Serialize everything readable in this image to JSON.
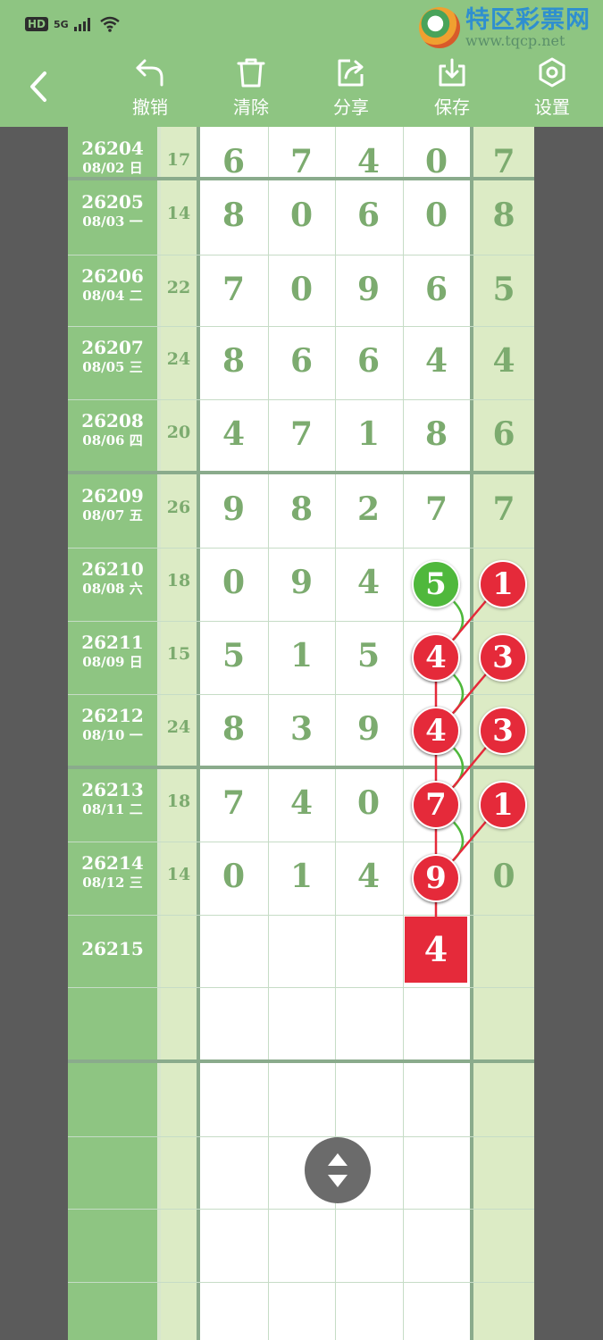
{
  "status_bar": {
    "hd": "HD",
    "network": "5G",
    "watermark_title": "特区彩票网",
    "watermark_url": "www.tqcp.net"
  },
  "toolbar": {
    "buttons": [
      {
        "label": "撤销",
        "icon": "undo-icon"
      },
      {
        "label": "清除",
        "icon": "trash-icon"
      },
      {
        "label": "分享",
        "icon": "share-icon"
      },
      {
        "label": "保存",
        "icon": "download-icon"
      },
      {
        "label": "设置",
        "icon": "settings-icon"
      }
    ]
  },
  "rows": [
    {
      "issue": "26204",
      "date": "08/02 日",
      "sum": "17",
      "digits": [
        "6",
        "7",
        "4",
        "0"
      ],
      "last": "7"
    },
    {
      "issue": "26205",
      "date": "08/03 一",
      "sum": "14",
      "digits": [
        "8",
        "0",
        "6",
        "0"
      ],
      "last": "8"
    },
    {
      "issue": "26206",
      "date": "08/04 二",
      "sum": "22",
      "digits": [
        "7",
        "0",
        "9",
        "6"
      ],
      "last": "5"
    },
    {
      "issue": "26207",
      "date": "08/05 三",
      "sum": "24",
      "digits": [
        "8",
        "6",
        "6",
        "4"
      ],
      "last": "4"
    },
    {
      "issue": "26208",
      "date": "08/06 四",
      "sum": "20",
      "digits": [
        "4",
        "7",
        "1",
        "8"
      ],
      "last": "6"
    },
    {
      "issue": "26209",
      "date": "08/07 五",
      "sum": "26",
      "digits": [
        "9",
        "8",
        "2",
        "7"
      ],
      "last": "7"
    },
    {
      "issue": "26210",
      "date": "08/08 六",
      "sum": "18",
      "digits": [
        "0",
        "9",
        "4",
        "5"
      ],
      "last": "1"
    },
    {
      "issue": "26211",
      "date": "08/09 日",
      "sum": "15",
      "digits": [
        "5",
        "1",
        "5",
        "4"
      ],
      "last": "3"
    },
    {
      "issue": "26212",
      "date": "08/10 一",
      "sum": "24",
      "digits": [
        "8",
        "3",
        "9",
        "4"
      ],
      "last": "3"
    },
    {
      "issue": "26213",
      "date": "08/11 二",
      "sum": "18",
      "digits": [
        "7",
        "4",
        "0",
        "7"
      ],
      "last": "1"
    },
    {
      "issue": "26214",
      "date": "08/12 三",
      "sum": "14",
      "digits": [
        "0",
        "1",
        "4",
        "9"
      ],
      "last": "0"
    },
    {
      "issue": "26215",
      "date": "",
      "sum": "",
      "digits": [
        "",
        "",
        "",
        ""
      ],
      "last": ""
    }
  ],
  "highlights": {
    "green_column": 3,
    "green_from_row": 6,
    "green_to_row": 10,
    "red_column4_from_row": 7,
    "red_column4_to_row": 10,
    "red_column5_from_row": 6,
    "red_column5_to_row": 9
  },
  "prediction": {
    "value": "4"
  },
  "colors": {
    "header_green": "#8ec582",
    "ball_green": "#4fb83c",
    "ball_red": "#e52a3a",
    "digit_text": "#7cab6f"
  }
}
